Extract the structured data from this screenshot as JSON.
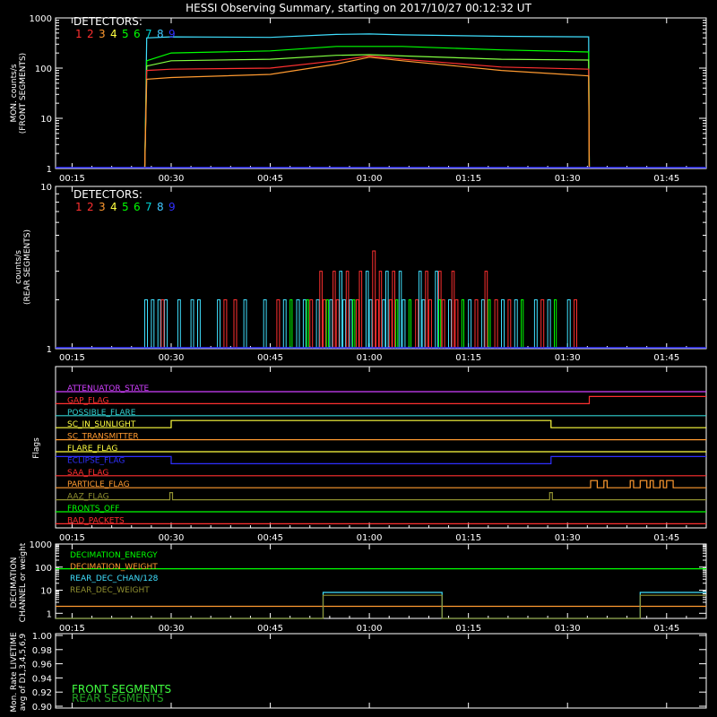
{
  "title": "HESSI Observing Summary, starting on 2017/10/27 00:12:32 UT",
  "time_ticks": [
    "00:15",
    "00:30",
    "00:45",
    "01:00",
    "01:15",
    "01:30",
    "01:45"
  ],
  "colors": {
    "axes": "#ffffff",
    "det": [
      "#ff3030",
      "#ff3030",
      "#ff9a30",
      "#ffff40",
      "#00ff00",
      "#00ff00",
      "#00d0d0",
      "#40c8ff",
      "#3030ff"
    ],
    "d4_line": "#ffff40",
    "label_blue": "#3050ff"
  },
  "detectors_title": "DETECTORS:",
  "detector_numbers": [
    "1",
    "2",
    "3",
    "4",
    "5",
    "6",
    "7",
    "8",
    "9"
  ],
  "chart_data": [
    {
      "type": "line",
      "name": "front",
      "ylabel_lines": [
        "MON. counts/s",
        "(FRONT SEGMENTS)"
      ],
      "yticks": [
        "1",
        "10",
        "100",
        "1000"
      ],
      "ylim": [
        1,
        1000
      ],
      "xlim_minutes": [
        12.5,
        111
      ],
      "series": [
        {
          "detector": "8",
          "color": "#40e0ff",
          "x": [
            26,
            26.3,
            30,
            45,
            55,
            60,
            65,
            80,
            93.2,
            93.3
          ],
          "y": [
            1,
            400,
            420,
            410,
            470,
            480,
            460,
            430,
            420,
            1
          ]
        },
        {
          "detector": "6",
          "color": "#00ff00",
          "x": [
            26,
            26.3,
            30,
            45,
            55,
            60,
            65,
            80,
            93.2,
            93.3
          ],
          "y": [
            1,
            140,
            200,
            220,
            270,
            270,
            270,
            230,
            210,
            1
          ]
        },
        {
          "detector": "5",
          "color": "#80ff40",
          "x": [
            26,
            26.3,
            30,
            45,
            55,
            60,
            65,
            80,
            93.2,
            93.3
          ],
          "y": [
            1,
            110,
            140,
            150,
            180,
            185,
            175,
            150,
            145,
            1
          ]
        },
        {
          "detector": "1",
          "color": "#ff3030",
          "x": [
            26,
            26.3,
            30,
            45,
            55,
            60,
            65,
            80,
            93.2,
            93.3
          ],
          "y": [
            1,
            90,
            95,
            100,
            140,
            175,
            150,
            105,
            95,
            1
          ]
        },
        {
          "detector": "3",
          "color": "#ff9a30",
          "x": [
            26,
            26.3,
            30,
            45,
            55,
            60,
            65,
            80,
            93.2,
            93.3
          ],
          "y": [
            1,
            60,
            65,
            75,
            120,
            165,
            140,
            90,
            70,
            1
          ]
        }
      ]
    },
    {
      "type": "line",
      "name": "rear",
      "ylabel_lines": [
        "counts/s",
        "(REAR SEGMENTS)"
      ],
      "yticks": [
        "1",
        "10"
      ],
      "ylim": [
        1,
        10
      ],
      "xlim_minutes": [
        12.5,
        111
      ],
      "base": 1,
      "series": [
        {
          "detector": "8",
          "color": "#40e0ff",
          "level": 2,
          "x": [
            26,
            27,
            28,
            29,
            31,
            33,
            34,
            37,
            41,
            44,
            47,
            49,
            50,
            52,
            54,
            56,
            57,
            60,
            62,
            65,
            68,
            72,
            75,
            77,
            80,
            82,
            85,
            87,
            90
          ],
          "width_min": 0.4
        },
        {
          "detector": "1",
          "color": "#ff3030",
          "level": 2,
          "x": [
            28.5,
            38,
            39.5,
            46,
            51,
            53,
            55,
            58,
            61,
            63,
            67,
            69,
            71,
            73,
            76,
            79,
            81,
            86,
            91
          ],
          "width_min": 0.4
        },
        {
          "detector": "1",
          "color": "#ff3030",
          "level": 3,
          "x": [
            52.5,
            54.5,
            56.5,
            58.5,
            61.5,
            63.5,
            68.5,
            70.5,
            72.5,
            77.5
          ],
          "width_min": 0.35
        },
        {
          "detector": "8",
          "color": "#40e0ff",
          "level": 3,
          "x": [
            55.5,
            59.5,
            62.5,
            64.5,
            67.5,
            70
          ],
          "width_min": 0.35
        },
        {
          "detector": "1",
          "color": "#ff3030",
          "level": 4,
          "x": [
            60.5
          ],
          "width_min": 0.4
        },
        {
          "detector": "6",
          "color": "#00ff00",
          "level": 2,
          "x": [
            48,
            50.5,
            53.5,
            57.5,
            64,
            66,
            70.5,
            74,
            78,
            83,
            88
          ],
          "width_min": 0.3
        }
      ]
    },
    {
      "type": "line",
      "name": "flags",
      "ylabel": "Flags",
      "flags": [
        {
          "label": "ATTENUATOR_STATE",
          "color": "#d040ff",
          "segments": [
            [
              12.5,
              111,
              0
            ]
          ]
        },
        {
          "label": "GAP_FLAG",
          "color": "#ff3030",
          "segments": [
            [
              12.5,
              93.3,
              0
            ],
            [
              93.3,
              111,
              1
            ]
          ]
        },
        {
          "label": "POSSIBLE_FLARE",
          "color": "#30d0d0",
          "segments": [
            [
              12.5,
              111,
              0
            ]
          ]
        },
        {
          "label": "SC_IN_SUNLIGHT",
          "color": "#ffff40",
          "segments": [
            [
              12.5,
              30,
              0
            ],
            [
              30,
              87.5,
              1
            ],
            [
              87.5,
              111,
              0
            ]
          ]
        },
        {
          "label": "SC_TRANSMITTER",
          "color": "#ff9a30",
          "segments": [
            [
              12.5,
              111,
              0
            ]
          ]
        },
        {
          "label": "FLARE_FLAG",
          "color": "#ffff40",
          "segments": [
            [
              12.5,
              111,
              0
            ]
          ]
        },
        {
          "label": "ECLIPSE_FLAG",
          "color": "#3030ff",
          "segments": [
            [
              12.5,
              30,
              1
            ],
            [
              30,
              87.5,
              0
            ],
            [
              87.5,
              111,
              1
            ]
          ]
        },
        {
          "label": "SAA_FLAG",
          "color": "#ff3030",
          "segments": [
            [
              12.5,
              111,
              0
            ]
          ]
        },
        {
          "label": "PARTICLE_FLAG",
          "color": "#ff9a30",
          "segments": [
            [
              12.5,
              93.5,
              0
            ],
            [
              93.5,
              94.5,
              1
            ],
            [
              94.5,
              95.5,
              0
            ],
            [
              95.5,
              96,
              1
            ],
            [
              96,
              99.5,
              0
            ],
            [
              99.5,
              100,
              1
            ],
            [
              100,
              101,
              0
            ],
            [
              101,
              102,
              1
            ],
            [
              102,
              102.5,
              0
            ],
            [
              102.5,
              103,
              1
            ],
            [
              103,
              104,
              0
            ],
            [
              104,
              104.5,
              1
            ],
            [
              104.5,
              105,
              0
            ],
            [
              105,
              106,
              1
            ],
            [
              106,
              111,
              0
            ]
          ]
        },
        {
          "label": "AAZ_FLAG",
          "color": "#909030",
          "segments": [
            [
              12.5,
              29.8,
              0
            ],
            [
              29.8,
              30.2,
              1
            ],
            [
              30.2,
              87.3,
              0
            ],
            [
              87.3,
              87.7,
              1
            ],
            [
              87.7,
              111,
              0
            ]
          ]
        },
        {
          "label": "FRONTS_OFF",
          "color": "#00ff00",
          "segments": [
            [
              12.5,
              111,
              0
            ]
          ]
        },
        {
          "label": "BAD_PACKETS",
          "color": "#ff3030",
          "segments": [
            [
              12.5,
              111,
              0
            ]
          ]
        }
      ]
    },
    {
      "type": "line",
      "name": "decimation",
      "ylabel_lines": [
        "DECIMATION",
        "CHANNEL or weight"
      ],
      "yticks": [
        "1",
        "10",
        "100",
        "1000"
      ],
      "ylim": [
        0.6,
        1000
      ],
      "legend": [
        {
          "label": "DECIMATION_ENERGY",
          "color": "#00ff00"
        },
        {
          "label": "DECIMATION_WEIGHT",
          "color": "#ff9a30"
        },
        {
          "label": "REAR_DEC_CHAN/128",
          "color": "#40e0ff"
        },
        {
          "label": "REAR_DEC_WEIGHT",
          "color": "#909030"
        }
      ],
      "series": [
        {
          "label": "DECIMATION_ENERGY",
          "color": "#00ff00",
          "x": [
            12.5,
            111
          ],
          "y": [
            85,
            85
          ]
        },
        {
          "label": "DECIMATION_WEIGHT",
          "color": "#ff9a30",
          "x": [
            12.5,
            111
          ],
          "y": [
            2,
            2
          ]
        },
        {
          "label": "REAR_DEC_CHAN/128",
          "color": "#40e0ff",
          "x": [
            12.5,
            53,
            53,
            71,
            71,
            101,
            101,
            111
          ],
          "y": [
            0.6,
            0.6,
            8,
            8,
            0.6,
            0.6,
            8,
            8
          ]
        },
        {
          "label": "REAR_DEC_WEIGHT",
          "color": "#909030",
          "x": [
            12.5,
            53,
            53,
            71,
            71,
            101,
            101,
            111
          ],
          "y": [
            0.6,
            0.6,
            6,
            6,
            0.6,
            0.6,
            6,
            6
          ]
        }
      ]
    },
    {
      "type": "line",
      "name": "livetime",
      "ylabel_lines": [
        "Mon. Rate LIVETIME",
        "avg of D1,3,4,5,6,9"
      ],
      "yticks": [
        "0.90",
        "0.92",
        "0.94",
        "0.96",
        "0.98",
        "1.00"
      ],
      "ylim": [
        0.9,
        1.0
      ],
      "legend": [
        {
          "label": "FRONT SEGMENTS",
          "color": "#40ff40"
        },
        {
          "label": "REAR SEGMENTS",
          "color": "#20a020"
        }
      ]
    }
  ]
}
